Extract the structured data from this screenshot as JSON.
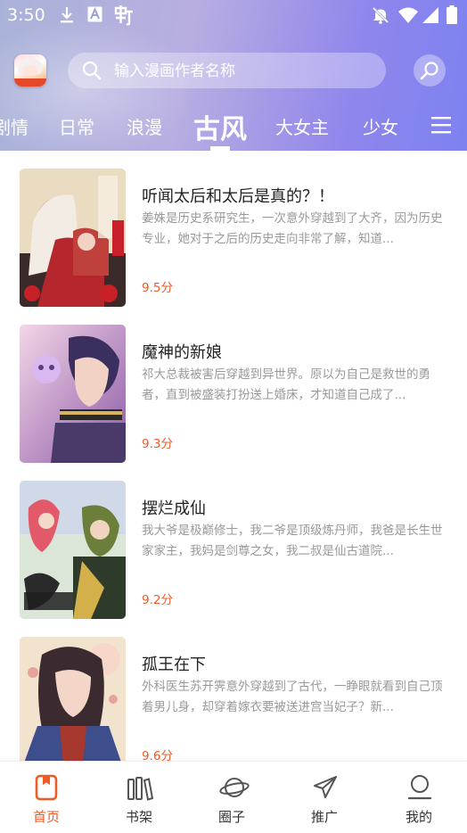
{
  "status_bar": {
    "time": "3:50",
    "left_icons": [
      "download-icon",
      "a-notification-icon",
      "app-notification-icon"
    ],
    "right_icons": [
      "bell-off-icon",
      "wifi-icon",
      "signal-icon",
      "battery-icon"
    ]
  },
  "search": {
    "placeholder": "输入漫画作者名称"
  },
  "tabs": [
    {
      "label": "剧情"
    },
    {
      "label": "日常"
    },
    {
      "label": "浪漫"
    },
    {
      "label": "古风",
      "active": true
    },
    {
      "label": "大女主"
    },
    {
      "label": "少女"
    }
  ],
  "comics": [
    {
      "title": "听闻太后和太后是真的？！",
      "description": "姜姝是历史系研究生，一次意外穿越到了大齐，因为历史专业，她对于之后的历史走向非常了解，知道...",
      "score": "9.5分"
    },
    {
      "title": "魔神的新娘",
      "description": "祁大总裁被害后穿越到异世界。原以为自己是救世的勇者，直到被盛装打扮送上婚床，才知道自己成了...",
      "score": "9.3分"
    },
    {
      "title": "摆烂成仙",
      "description": "我大爷是极巅修士，我二爷是顶级炼丹师，我爸是长生世家家主，我妈是剑尊之女，我二叔是仙古道院...",
      "score": "9.2分"
    },
    {
      "title": "孤王在下",
      "description": "外科医生苏开霁意外穿越到了古代，一睁眼就看到自己顶着男儿身，却穿着嫁衣要被送进宫当妃子？新...",
      "score": "9.6分"
    }
  ],
  "bottom_nav": [
    {
      "label": "首页",
      "icon": "home-book-icon",
      "active": true
    },
    {
      "label": "书架",
      "icon": "bookshelf-icon"
    },
    {
      "label": "圈子",
      "icon": "planet-icon"
    },
    {
      "label": "推广",
      "icon": "paper-plane-icon"
    },
    {
      "label": "我的",
      "icon": "profile-icon"
    }
  ],
  "colors": {
    "accent": "#f15a24",
    "header_gradient_start": "#a9b3d8",
    "header_gradient_end": "#7d82f0",
    "title_text": "#222222",
    "desc_text": "#999999"
  }
}
